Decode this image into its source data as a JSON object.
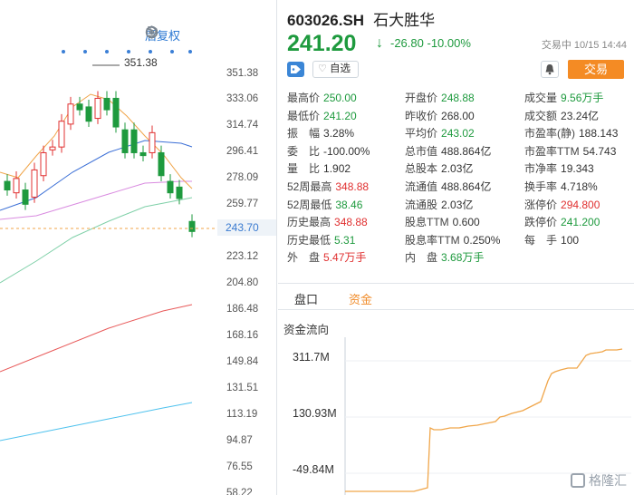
{
  "chart": {
    "adjust_label": "后复权",
    "max_marker": "351.38",
    "current_tag": "243.70",
    "price_axis": [
      "351.38",
      "333.06",
      "314.74",
      "296.41",
      "278.09",
      "259.77",
      "223.12",
      "204.80",
      "186.48",
      "168.16",
      "149.84",
      "131.51",
      "113.19",
      "94.87",
      "76.55",
      "58.22"
    ]
  },
  "chart_data": {
    "type": "candlestick",
    "ylim": [
      58.22,
      351.38
    ],
    "candles": [
      {
        "o": 276,
        "c": 270
      },
      {
        "o": 268,
        "c": 278
      },
      {
        "o": 270,
        "c": 260
      },
      {
        "o": 265,
        "c": 284
      },
      {
        "o": 280,
        "c": 296
      },
      {
        "o": 298,
        "c": 300
      },
      {
        "o": 300,
        "c": 318
      },
      {
        "o": 316,
        "c": 330
      },
      {
        "o": 330,
        "c": 326
      },
      {
        "o": 328,
        "c": 318
      },
      {
        "o": 320,
        "c": 334
      },
      {
        "o": 334,
        "c": 326
      },
      {
        "o": 334,
        "c": 314
      },
      {
        "o": 312,
        "c": 296
      },
      {
        "o": 312,
        "c": 296
      },
      {
        "o": 296,
        "c": 294
      },
      {
        "o": 296,
        "c": 310
      },
      {
        "o": 296,
        "c": 280
      },
      {
        "o": 276,
        "c": 268
      },
      {
        "o": 272,
        "c": 264
      },
      {
        "o": 248,
        "c": 241
      }
    ]
  },
  "quote": {
    "code": "603026.SH",
    "name": "石大胜华",
    "price": "241.20",
    "arrow": "↓",
    "change": "-26.80",
    "change_pct": "-10.00%",
    "trade_time": "交易中 10/15 14:44",
    "watch_label": "自选",
    "trade_label": "交易",
    "colors": {
      "down": "#1e9a3e",
      "up": "#e03030",
      "accent": "#f48b24"
    },
    "rows": [
      [
        {
          "l": "最高价",
          "v": "250.00",
          "c": "g"
        },
        {
          "l": "开盘价",
          "v": "248.88",
          "c": "g"
        },
        {
          "l": "成交量",
          "v": "9.56万手",
          "c": "g"
        }
      ],
      [
        {
          "l": "最低价",
          "v": "241.20",
          "c": "g"
        },
        {
          "l": "昨收价",
          "v": "268.00",
          "c": "k"
        },
        {
          "l": "成交额",
          "v": "23.24亿",
          "c": "k"
        }
      ],
      [
        {
          "l": "振　幅",
          "v": "3.28%",
          "c": "k"
        },
        {
          "l": "平均价",
          "v": "243.02",
          "c": "g"
        },
        {
          "l": "市盈率(静)",
          "v": "188.143",
          "c": "k"
        }
      ],
      [
        {
          "l": "委　比",
          "v": "-100.00%",
          "c": "k"
        },
        {
          "l": "总市值",
          "v": "488.864亿",
          "c": "k"
        },
        {
          "l": "市盈率TTM",
          "v": "54.743",
          "c": "k"
        }
      ],
      [
        {
          "l": "量　比",
          "v": "1.902",
          "c": "k"
        },
        {
          "l": "总股本",
          "v": "2.03亿",
          "c": "k"
        },
        {
          "l": "市净率",
          "v": "19.343",
          "c": "k"
        }
      ],
      [
        {
          "l": "52周最高",
          "v": "348.88",
          "c": "r"
        },
        {
          "l": "流通值",
          "v": "488.864亿",
          "c": "k"
        },
        {
          "l": "换手率",
          "v": "4.718%",
          "c": "k"
        }
      ],
      [
        {
          "l": "52周最低",
          "v": "38.46",
          "c": "g"
        },
        {
          "l": "流通股",
          "v": "2.03亿",
          "c": "k"
        },
        {
          "l": "涨停价",
          "v": "294.800",
          "c": "r"
        }
      ],
      [
        {
          "l": "历史最高",
          "v": "348.88",
          "c": "r"
        },
        {
          "l": "股息TTM",
          "v": "0.600",
          "c": "k"
        },
        {
          "l": "跌停价",
          "v": "241.200",
          "c": "g"
        }
      ],
      [
        {
          "l": "历史最低",
          "v": "5.31",
          "c": "g"
        },
        {
          "l": "股息率TTM",
          "v": "0.250%",
          "c": "k"
        },
        {
          "l": "每　手",
          "v": "100",
          "c": "k"
        }
      ],
      [
        {
          "l": "外　盘",
          "v": "5.47万手",
          "c": "r"
        },
        {
          "l": "内　盘",
          "v": "3.68万手",
          "c": "g"
        },
        null
      ]
    ],
    "tabs": [
      "盘口",
      "资金"
    ],
    "flow_title": "资金流向",
    "flow_labels": [
      "311.7M",
      "130.93M",
      "-49.84M"
    ]
  },
  "watermark": "格隆汇"
}
